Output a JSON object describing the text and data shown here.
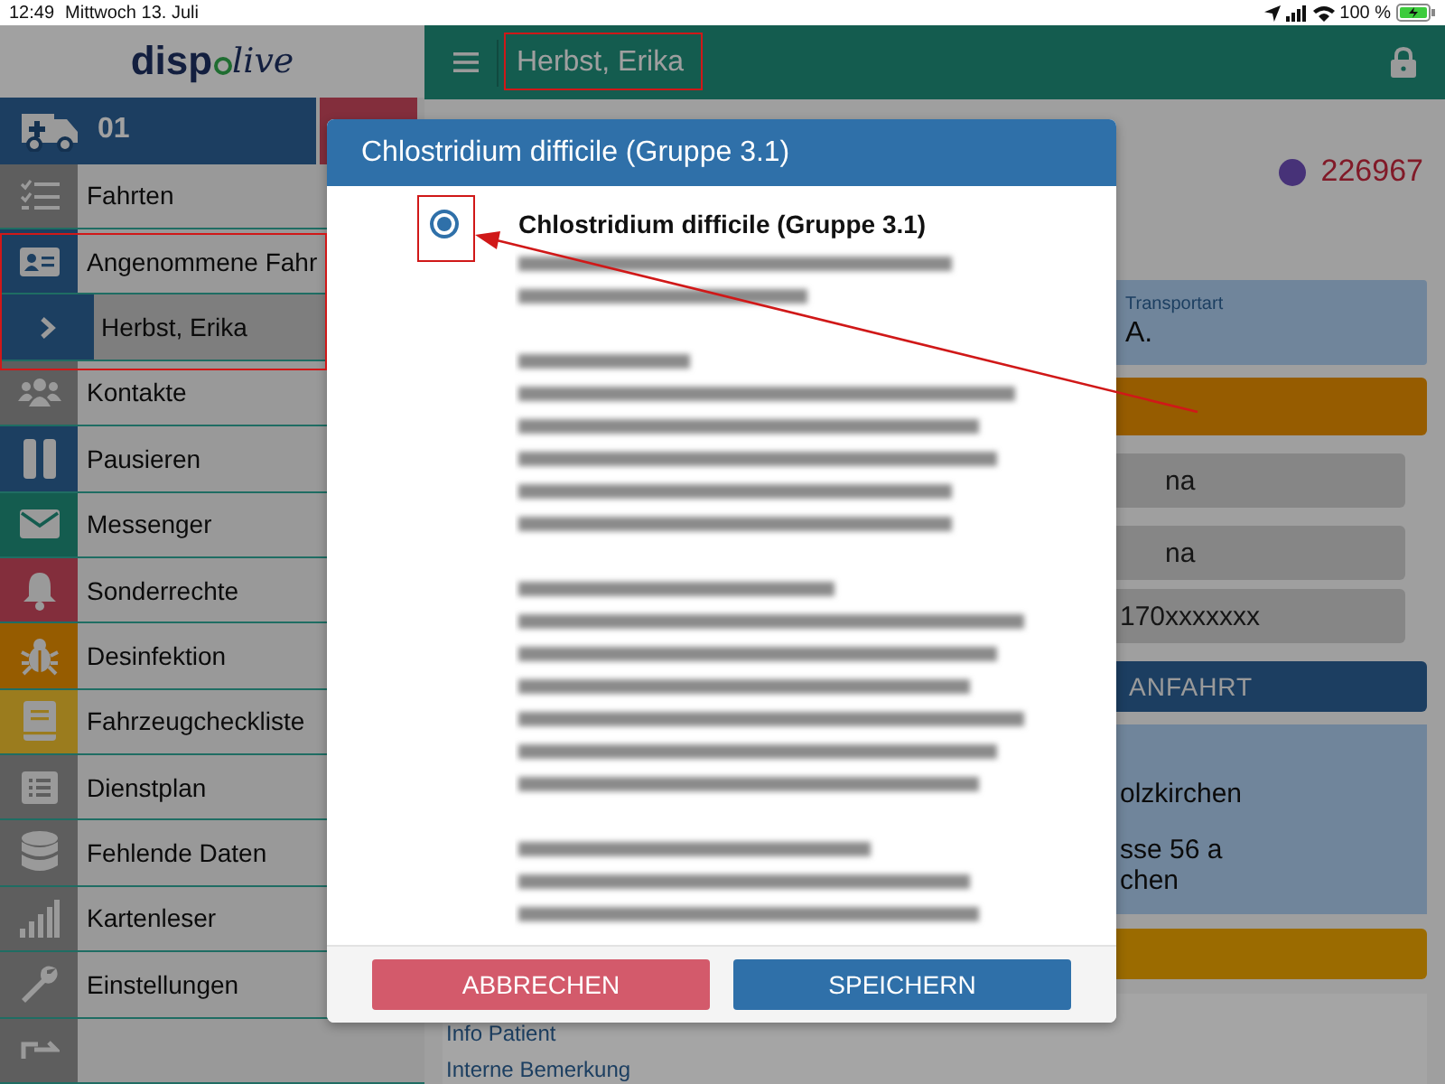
{
  "status_bar": {
    "time": "12:49",
    "date": "Mittwoch 13. Juli",
    "battery": "100 %"
  },
  "logo": {
    "left": "disp",
    "right": "live"
  },
  "header": {
    "title": "Herbst, Erika"
  },
  "vehicle": {
    "label": "01"
  },
  "sidebar": {
    "items": [
      {
        "label": "Fahrten",
        "kind": "checklist",
        "selected": false
      },
      {
        "label": "Angenommene Fahr",
        "kind": "idcard",
        "selected": false,
        "children": [
          {
            "label": "Herbst, Erika",
            "kind": "chevron",
            "selected": true
          }
        ]
      },
      {
        "label": "Kontakte",
        "kind": "people",
        "selected": false
      },
      {
        "label": "Pausieren",
        "kind": "pause",
        "selected": false
      },
      {
        "label": "Messenger",
        "kind": "envelope",
        "selected": false
      },
      {
        "label": "Sonderrechte",
        "kind": "bell",
        "selected": false
      },
      {
        "label": "Desinfektion",
        "kind": "bug",
        "selected": false
      },
      {
        "label": "Fahrzeugcheckliste",
        "kind": "book",
        "selected": false
      },
      {
        "label": "Dienstplan",
        "kind": "list",
        "selected": false
      },
      {
        "label": "Fehlende Daten",
        "kind": "database",
        "selected": false
      },
      {
        "label": "Kartenleser",
        "kind": "signal",
        "selected": false
      },
      {
        "label": "Einstellungen",
        "kind": "wrench",
        "selected": false
      },
      {
        "kind": "exit",
        "selected": false
      }
    ]
  },
  "content": {
    "number": "226967",
    "transport_label": "Transportart",
    "transport_value": "A.",
    "field_1": "na",
    "field_2": "na",
    "phone": "170xxxxxxx",
    "anfahrt": "ANFAHRT",
    "address_lines": [
      "olzkirchen",
      "sse 56 a",
      "chen"
    ],
    "links": [
      "Info Patient",
      "Interne Bemerkung"
    ]
  },
  "dialog": {
    "title": "Chlostridium difficile (Gruppe 3.1)",
    "option": {
      "label": "Chlostridium difficile (Gruppe 3.1)",
      "selected": true
    },
    "cancel": "ABBRECHEN",
    "save": "SPEICHERN"
  }
}
